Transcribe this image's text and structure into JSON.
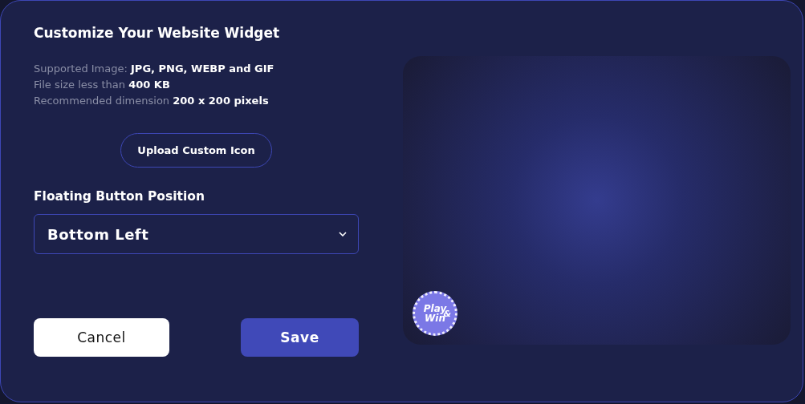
{
  "dialog": {
    "title": "Customize Your Website Widget"
  },
  "requirements": [
    {
      "label": "Supported Image:",
      "value": "JPG, PNG, WEBP and GIF"
    },
    {
      "label": "File size less than",
      "value": "400 KB"
    },
    {
      "label": "Recommended dimension",
      "value": "200 x 200 pixels"
    }
  ],
  "upload_button": "Upload Custom Icon",
  "position": {
    "label": "Floating Button Position",
    "value": "Bottom Left"
  },
  "buttons": [
    {
      "kind": "secondary",
      "label": "Cancel"
    },
    {
      "kind": "primary",
      "label": "Save"
    }
  ],
  "preview": {
    "badge": {
      "line_1": "Play",
      "line_2": "Win",
      "ampersand": "&"
    }
  }
}
